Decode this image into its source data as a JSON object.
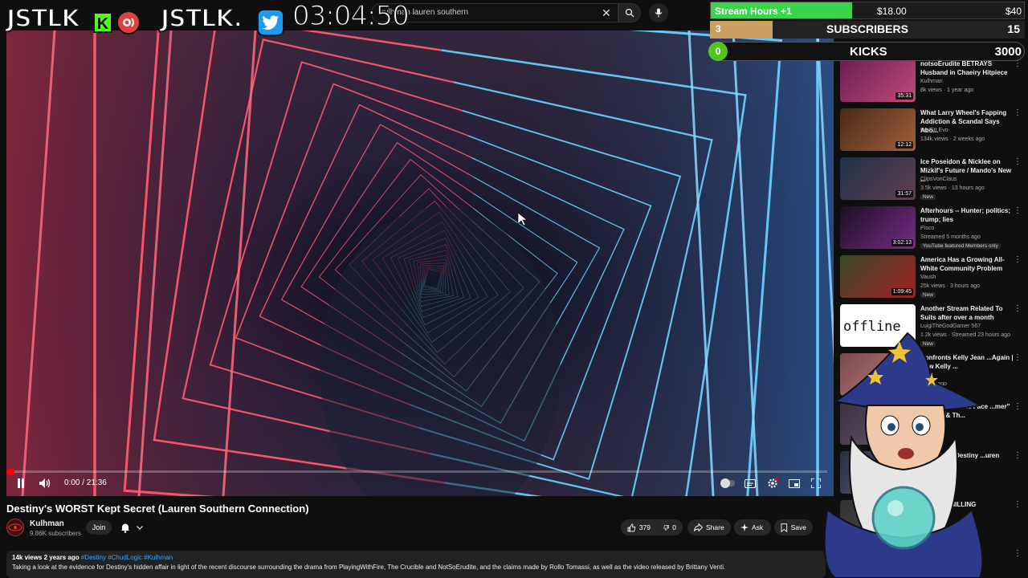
{
  "search": {
    "query": "kulhman lauren southern"
  },
  "video": {
    "current_time": "0:00 / 21:36",
    "progress_fraction": 0.005
  },
  "meta": {
    "title": "Destiny's WORST Kept Secret (Lauren Southern Connection)",
    "channel": "Kulhman",
    "subscribers": "9.86K subscribers",
    "join_label": "Join",
    "likes": "379",
    "dislikes": "0",
    "share_label": "Share",
    "ask_label": "Ask",
    "save_label": "Save",
    "views_date": "14k views  2 years ago",
    "tags": "#Destiny #ChudLogic #Kulhman",
    "description": "Taking a look at the evidence for Destiny's hidden affair in light of the recent discourse surrounding the drama from PlayingWithFire, The Crucible and NotSoErudite, and the claims made by Rollo Tomassi, as well as the video released by Brittany Venti."
  },
  "recommendations": [
    {
      "title": "notsoErudite BETRAYS Husband in Chaeiry Hitpiece",
      "channel": "Kulhman",
      "meta": "8k views · 1 year ago",
      "duration": "35:31",
      "badge": ""
    },
    {
      "title": "What Larry Wheel's Fapping Addiction & Scandal Says Abo...",
      "channel": "ProFitt Evo",
      "meta": "134k views · 2 weeks ago",
      "duration": "12:12",
      "badge": ""
    },
    {
      "title": "Ice Poseidon & Nicklee on Mizkif's Future / Mando's New ...",
      "channel": "ClipsVonClaus",
      "meta": "3.5k views · 13 hours ago",
      "duration": "31:57",
      "badge": "New"
    },
    {
      "title": "Afterhours -- Hunter; politics; trump; lies",
      "channel": "Pisco",
      "meta": "Streamed 5 months ago",
      "duration": "3:02:13",
      "badge": "YouTube featured  Members only"
    },
    {
      "title": "America Has a Growing All-White Community Problem",
      "channel": "Vaush",
      "meta": "25k views · 3 hours ago",
      "duration": "1:09:45",
      "badge": "New"
    },
    {
      "title": "Another Stream Related To Suits after over a month",
      "channel": "LuigiTheGodGamer 567",
      "meta": "1.2k views · Streamed 23 hours ago",
      "duration": "",
      "badge": "New"
    },
    {
      "title": "Confronts Kelly Jean ...Again | New Kelly ...",
      "channel": "Vault",
      "meta": "1 year ago",
      "duration": "",
      "badge": ""
    },
    {
      "title": "Hit Myself In The Face ...mer\" Michael & Th...",
      "channel": "",
      "meta": "...ago",
      "duration": "",
      "badge": ""
    },
    {
      "title": "...ble Grills Destiny ...uren Southern",
      "channel": "",
      "meta": "...ago",
      "duration": "",
      "badge": ""
    },
    {
      "title": "...hakes CHILLING",
      "channel": "",
      "meta": "",
      "duration": "",
      "badge": ""
    },
    {
      "title": "...ble",
      "channel": "",
      "meta": "...views · 10 hours ago",
      "duration": "29:24",
      "badge": ""
    }
  ],
  "overlay": {
    "logo_text": "JSTLK",
    "logo_text2": "JSTLK",
    "logo_suffix": ".",
    "kick_letter": "K",
    "clock": "03:04:50",
    "goal_label": "Stream Hours +1",
    "goal_current": "$18.00",
    "goal_max": "$40",
    "goal_fraction": 0.45,
    "subs_current": "3",
    "subs_label": "SUBSCRIBERS",
    "subs_max": "15",
    "subs_fraction": 0.2,
    "kicks_current": "0",
    "kicks_label": "KICKS",
    "kicks_max": "3000"
  },
  "colors": {
    "accent_red": "#ff0000",
    "kick_green": "#53fc18",
    "goal_green": "#3bd34a",
    "twitter_blue": "#1d9bf0"
  }
}
